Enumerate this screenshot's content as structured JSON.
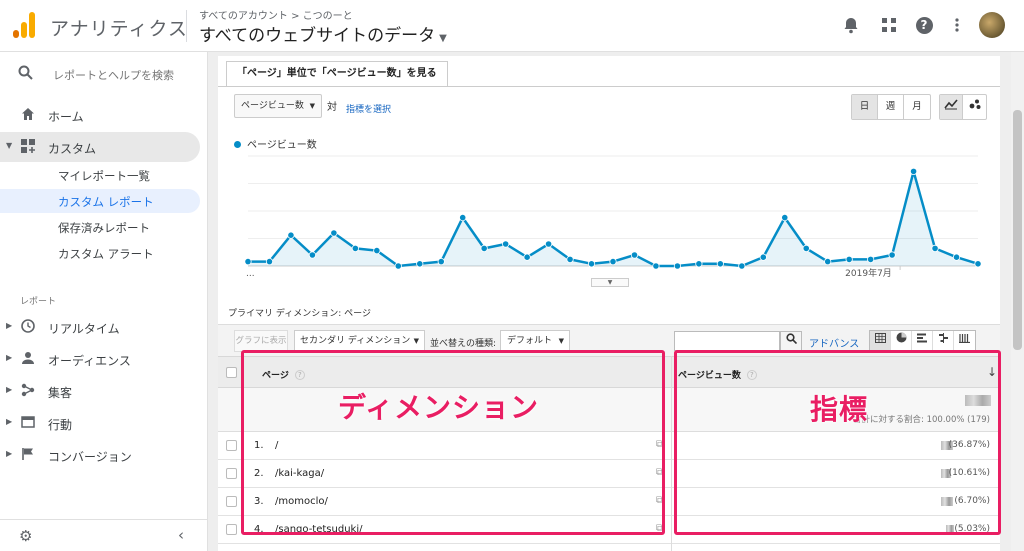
{
  "header": {
    "app_title": "アナリティクス",
    "breadcrumb": "すべてのアカウント > こつのーと",
    "property_view": "すべてのウェブサイトのデータ"
  },
  "sidebar": {
    "search_placeholder": "レポートとヘルプを検索",
    "home": "ホーム",
    "custom": "カスタム",
    "custom_items": [
      "マイレポート一覧",
      "カスタム レポート",
      "保存済みレポート",
      "カスタム アラート"
    ],
    "reports_section": "レポート",
    "report_items": [
      "リアルタイム",
      "オーディエンス",
      "集客",
      "行動",
      "コンバージョン"
    ]
  },
  "report": {
    "tab_label": "「ページ」単位で「ページビュー数」を見る",
    "metric_select": "ページビュー数",
    "vs_label": "対",
    "choose_metric": "指標を選択",
    "periods": [
      "日",
      "週",
      "月"
    ],
    "active_period": "日",
    "primary_dimension": "プライマリ ディメンション:  ページ",
    "graph_button": "グラフに表示",
    "secondary_dimension": "セカンダリ ディメンション",
    "sort_label": "並べ替えの種類:",
    "sort_value": "デフォルト",
    "advanced": "アドバンス"
  },
  "chart_data": {
    "type": "line",
    "series": [
      {
        "name": "ページビュー数",
        "color": "#058dc7",
        "values": [
          2,
          2,
          14,
          5,
          15,
          8,
          7,
          0,
          1,
          2,
          22,
          8,
          10,
          4,
          10,
          3,
          1,
          2,
          5,
          0,
          0,
          1,
          1,
          0,
          4,
          22,
          8,
          2,
          3,
          3,
          5,
          43,
          8,
          4,
          1
        ]
      }
    ],
    "x_tick_labels": [
      "...",
      "2019年7月"
    ],
    "ylim": [
      0,
      50
    ],
    "grid": true,
    "area_fill": true,
    "legend_position": "top-left"
  },
  "table": {
    "col_page": "ページ",
    "col_pageviews": "ページビュー数",
    "total_pct": "合計に対する割合: 100.00% (179)",
    "rows": [
      {
        "num": "1.",
        "path": "/",
        "pct": "(36.87%)"
      },
      {
        "num": "2.",
        "path": "/kai-kaga/",
        "pct": "(10.61%)"
      },
      {
        "num": "3.",
        "path": "/momoclo/",
        "pct": "(6.70%)"
      },
      {
        "num": "4.",
        "path": "/sango-tetsuduki/",
        "pct": "(5.03%)"
      }
    ]
  },
  "annotations": {
    "dimension": "ディメンション",
    "metric": "指標",
    "color": "#e91e63"
  }
}
